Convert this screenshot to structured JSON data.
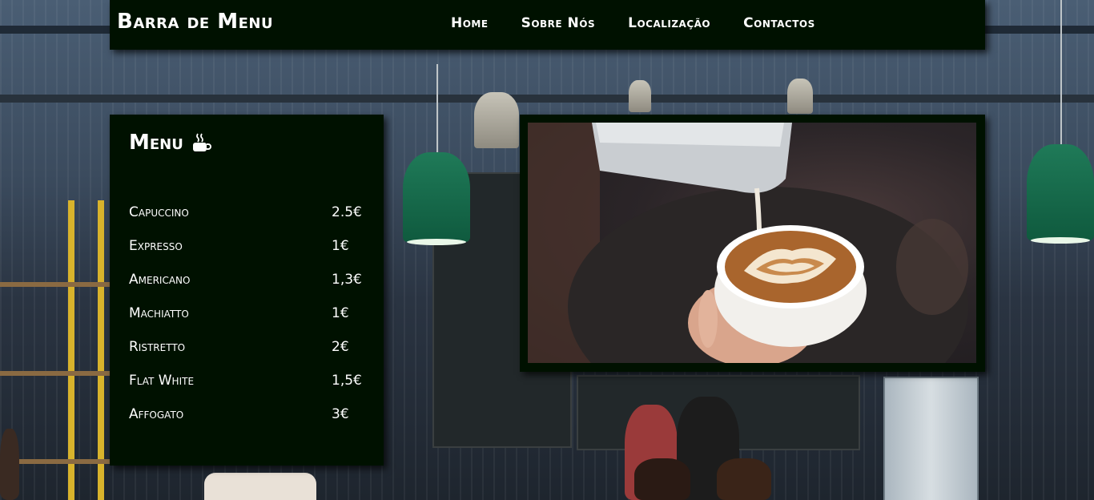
{
  "navbar": {
    "brand": "Barra de Menu",
    "links": [
      {
        "label": "Home"
      },
      {
        "label": "Sobre Nós"
      },
      {
        "label": "Localização"
      },
      {
        "label": "Contactos"
      }
    ]
  },
  "menu": {
    "title": "Menu",
    "title_icon": "coffee-cup-icon",
    "items": [
      {
        "name": "Capuccino",
        "price": "2.5€"
      },
      {
        "name": "Expresso",
        "price": "1€"
      },
      {
        "name": "Americano",
        "price": "1,3€"
      },
      {
        "name": "Machiatto",
        "price": "1€"
      },
      {
        "name": "Ristretto",
        "price": "2€"
      },
      {
        "name": "Flat White",
        "price": "1,5€"
      },
      {
        "name": "Affogato",
        "price": "3€"
      }
    ]
  },
  "photo": {
    "subject": "latte-art-photo"
  },
  "colors": {
    "panel_bg": "#001100",
    "text": "#ffffff"
  }
}
